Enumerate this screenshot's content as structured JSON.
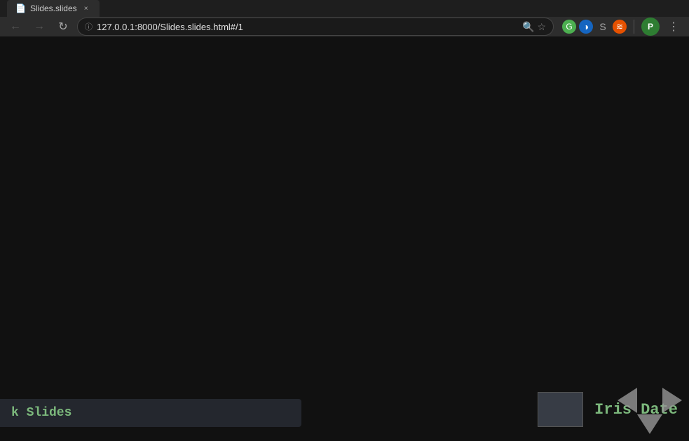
{
  "browser": {
    "tab": {
      "title": "Slides.slides",
      "favicon": "📄"
    },
    "nav": {
      "back_disabled": true,
      "forward_disabled": true,
      "refresh_label": "↻",
      "url": "127.0.0.1:8000/Slides.slides.html#/1"
    },
    "extensions": [
      {
        "id": "search",
        "icon": "🔍",
        "color": "#888"
      },
      {
        "id": "bookmark",
        "icon": "☆",
        "color": "#888"
      },
      {
        "id": "ext1",
        "letter": "G",
        "color": "#4caf50"
      },
      {
        "id": "ext2",
        "letter": "◑",
        "color": "#1565c0"
      },
      {
        "id": "ext3",
        "letter": "S",
        "color": "#888"
      },
      {
        "id": "ext4",
        "letter": "≋",
        "color": "#e65100"
      }
    ],
    "profile": {
      "letter": "P",
      "color": "#2e7d32"
    },
    "menu_label": "⋮"
  },
  "slide": {
    "background_color": "#111111",
    "left_label": "k Slides",
    "right_title": "Iris Date",
    "thumbnail_color": "#3a3d47",
    "nav_arrows": {
      "left_label": "◄",
      "right_label": "►",
      "down_label": "▼"
    }
  }
}
